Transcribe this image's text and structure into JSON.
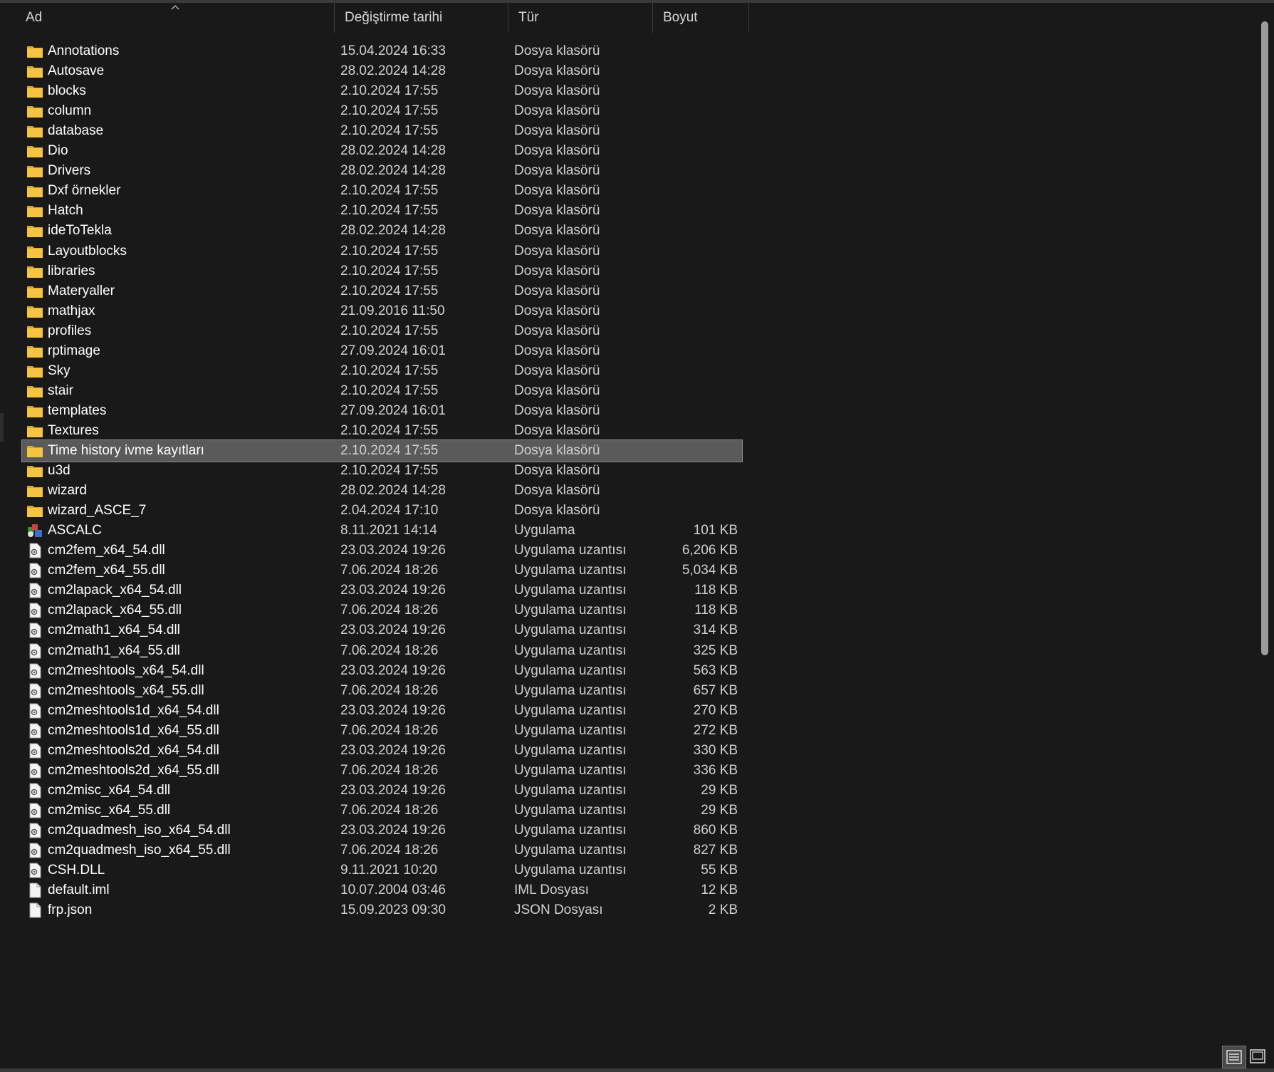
{
  "columns": {
    "name": "Ad",
    "date": "Değiştirme tarihi",
    "type": "Tür",
    "size": "Boyut"
  },
  "colors": {
    "background": "#191919",
    "selected": "#5a5a5a",
    "folder": "#f5c542"
  },
  "files": [
    {
      "name": "Annotations",
      "date": "15.04.2024 16:33",
      "type": "Dosya klasörü",
      "size": "",
      "icon": "folder-icon"
    },
    {
      "name": "Autosave",
      "date": "28.02.2024 14:28",
      "type": "Dosya klasörü",
      "size": "",
      "icon": "folder-icon"
    },
    {
      "name": "blocks",
      "date": "2.10.2024 17:55",
      "type": "Dosya klasörü",
      "size": "",
      "icon": "folder-icon"
    },
    {
      "name": "column",
      "date": "2.10.2024 17:55",
      "type": "Dosya klasörü",
      "size": "",
      "icon": "folder-icon"
    },
    {
      "name": "database",
      "date": "2.10.2024 17:55",
      "type": "Dosya klasörü",
      "size": "",
      "icon": "folder-icon"
    },
    {
      "name": "Dio",
      "date": "28.02.2024 14:28",
      "type": "Dosya klasörü",
      "size": "",
      "icon": "folder-icon"
    },
    {
      "name": "Drivers",
      "date": "28.02.2024 14:28",
      "type": "Dosya klasörü",
      "size": "",
      "icon": "folder-icon"
    },
    {
      "name": "Dxf örnekler",
      "date": "2.10.2024 17:55",
      "type": "Dosya klasörü",
      "size": "",
      "icon": "folder-icon"
    },
    {
      "name": "Hatch",
      "date": "2.10.2024 17:55",
      "type": "Dosya klasörü",
      "size": "",
      "icon": "folder-icon"
    },
    {
      "name": "ideToTekla",
      "date": "28.02.2024 14:28",
      "type": "Dosya klasörü",
      "size": "",
      "icon": "folder-icon"
    },
    {
      "name": "Layoutblocks",
      "date": "2.10.2024 17:55",
      "type": "Dosya klasörü",
      "size": "",
      "icon": "folder-icon"
    },
    {
      "name": "libraries",
      "date": "2.10.2024 17:55",
      "type": "Dosya klasörü",
      "size": "",
      "icon": "folder-icon"
    },
    {
      "name": "Materyaller",
      "date": "2.10.2024 17:55",
      "type": "Dosya klasörü",
      "size": "",
      "icon": "folder-icon"
    },
    {
      "name": "mathjax",
      "date": "21.09.2016 11:50",
      "type": "Dosya klasörü",
      "size": "",
      "icon": "folder-icon"
    },
    {
      "name": "profiles",
      "date": "2.10.2024 17:55",
      "type": "Dosya klasörü",
      "size": "",
      "icon": "folder-icon"
    },
    {
      "name": "rptimage",
      "date": "27.09.2024 16:01",
      "type": "Dosya klasörü",
      "size": "",
      "icon": "folder-icon"
    },
    {
      "name": "Sky",
      "date": "2.10.2024 17:55",
      "type": "Dosya klasörü",
      "size": "",
      "icon": "folder-icon"
    },
    {
      "name": "stair",
      "date": "2.10.2024 17:55",
      "type": "Dosya klasörü",
      "size": "",
      "icon": "folder-icon"
    },
    {
      "name": "templates",
      "date": "27.09.2024 16:01",
      "type": "Dosya klasörü",
      "size": "",
      "icon": "folder-icon"
    },
    {
      "name": "Textures",
      "date": "2.10.2024 17:55",
      "type": "Dosya klasörü",
      "size": "",
      "icon": "folder-icon"
    },
    {
      "name": "Time history ivme kayıtları",
      "date": "2.10.2024 17:55",
      "type": "Dosya klasörü",
      "size": "",
      "icon": "folder-icon",
      "selected": true
    },
    {
      "name": "u3d",
      "date": "2.10.2024 17:55",
      "type": "Dosya klasörü",
      "size": "",
      "icon": "folder-icon"
    },
    {
      "name": "wizard",
      "date": "28.02.2024 14:28",
      "type": "Dosya klasörü",
      "size": "",
      "icon": "folder-icon"
    },
    {
      "name": "wizard_ASCE_7",
      "date": "2.04.2024 17:10",
      "type": "Dosya klasörü",
      "size": "",
      "icon": "folder-icon"
    },
    {
      "name": "ASCALC",
      "date": "8.11.2021 14:14",
      "type": "Uygulama",
      "size": "101 KB",
      "icon": "application-icon"
    },
    {
      "name": "cm2fem_x64_54.dll",
      "date": "23.03.2024 19:26",
      "type": "Uygulama uzantısı",
      "size": "6,206 KB",
      "icon": "dll-icon"
    },
    {
      "name": "cm2fem_x64_55.dll",
      "date": "7.06.2024 18:26",
      "type": "Uygulama uzantısı",
      "size": "5,034 KB",
      "icon": "dll-icon"
    },
    {
      "name": "cm2lapack_x64_54.dll",
      "date": "23.03.2024 19:26",
      "type": "Uygulama uzantısı",
      "size": "118 KB",
      "icon": "dll-icon"
    },
    {
      "name": "cm2lapack_x64_55.dll",
      "date": "7.06.2024 18:26",
      "type": "Uygulama uzantısı",
      "size": "118 KB",
      "icon": "dll-icon"
    },
    {
      "name": "cm2math1_x64_54.dll",
      "date": "23.03.2024 19:26",
      "type": "Uygulama uzantısı",
      "size": "314 KB",
      "icon": "dll-icon"
    },
    {
      "name": "cm2math1_x64_55.dll",
      "date": "7.06.2024 18:26",
      "type": "Uygulama uzantısı",
      "size": "325 KB",
      "icon": "dll-icon"
    },
    {
      "name": "cm2meshtools_x64_54.dll",
      "date": "23.03.2024 19:26",
      "type": "Uygulama uzantısı",
      "size": "563 KB",
      "icon": "dll-icon"
    },
    {
      "name": "cm2meshtools_x64_55.dll",
      "date": "7.06.2024 18:26",
      "type": "Uygulama uzantısı",
      "size": "657 KB",
      "icon": "dll-icon"
    },
    {
      "name": "cm2meshtools1d_x64_54.dll",
      "date": "23.03.2024 19:26",
      "type": "Uygulama uzantısı",
      "size": "270 KB",
      "icon": "dll-icon"
    },
    {
      "name": "cm2meshtools1d_x64_55.dll",
      "date": "7.06.2024 18:26",
      "type": "Uygulama uzantısı",
      "size": "272 KB",
      "icon": "dll-icon"
    },
    {
      "name": "cm2meshtools2d_x64_54.dll",
      "date": "23.03.2024 19:26",
      "type": "Uygulama uzantısı",
      "size": "330 KB",
      "icon": "dll-icon"
    },
    {
      "name": "cm2meshtools2d_x64_55.dll",
      "date": "7.06.2024 18:26",
      "type": "Uygulama uzantısı",
      "size": "336 KB",
      "icon": "dll-icon"
    },
    {
      "name": "cm2misc_x64_54.dll",
      "date": "23.03.2024 19:26",
      "type": "Uygulama uzantısı",
      "size": "29 KB",
      "icon": "dll-icon"
    },
    {
      "name": "cm2misc_x64_55.dll",
      "date": "7.06.2024 18:26",
      "type": "Uygulama uzantısı",
      "size": "29 KB",
      "icon": "dll-icon"
    },
    {
      "name": "cm2quadmesh_iso_x64_54.dll",
      "date": "23.03.2024 19:26",
      "type": "Uygulama uzantısı",
      "size": "860 KB",
      "icon": "dll-icon"
    },
    {
      "name": "cm2quadmesh_iso_x64_55.dll",
      "date": "7.06.2024 18:26",
      "type": "Uygulama uzantısı",
      "size": "827 KB",
      "icon": "dll-icon"
    },
    {
      "name": "CSH.DLL",
      "date": "9.11.2021 10:20",
      "type": "Uygulama uzantısı",
      "size": "55 KB",
      "icon": "dll-icon"
    },
    {
      "name": "default.iml",
      "date": "10.07.2004 03:46",
      "type": "IML Dosyası",
      "size": "12 KB",
      "icon": "file-icon"
    },
    {
      "name": "frp.json",
      "date": "15.09.2023 09:30",
      "type": "JSON Dosyası",
      "size": "2 KB",
      "icon": "file-icon"
    }
  ],
  "view_buttons": [
    {
      "icon": "details-view-icon",
      "active": true
    },
    {
      "icon": "large-icons-view-icon",
      "active": false
    }
  ]
}
